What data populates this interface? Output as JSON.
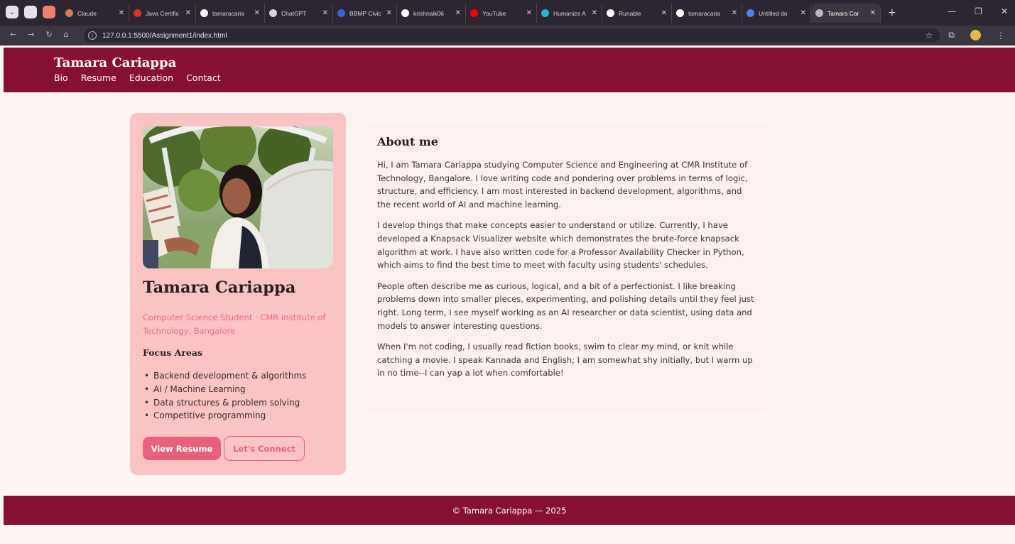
{
  "browser": {
    "tabs": [
      {
        "label": "Claude",
        "icon": "claude-icon",
        "color": "#d97757"
      },
      {
        "label": "Java Certific",
        "icon": "java-icon",
        "color": "#e02e2e"
      },
      {
        "label": "tamaracaria",
        "icon": "github-icon",
        "color": "#ffffff"
      },
      {
        "label": "ChatGPT",
        "icon": "chatgpt-icon",
        "color": "#d9d4dc"
      },
      {
        "label": "BBMP Civic",
        "icon": "bbmp-icon",
        "color": "#3366dd"
      },
      {
        "label": "krishnaik06",
        "icon": "github-icon",
        "color": "#ffffff"
      },
      {
        "label": "YouTube",
        "icon": "youtube-icon",
        "color": "#ff0000"
      },
      {
        "label": "Humanize A",
        "icon": "humanize-icon",
        "color": "#28b4d8"
      },
      {
        "label": "Runable",
        "icon": "runable-icon",
        "color": "#ffffff"
      },
      {
        "label": "tamaracaria",
        "icon": "github-icon",
        "color": "#ffffff"
      },
      {
        "label": "Untitled do",
        "icon": "docs-icon",
        "color": "#4285f4"
      },
      {
        "label": "Tamara Car",
        "icon": "globe-icon",
        "color": "#bdb6c1"
      }
    ],
    "url": "127.0.0.1:5500/Assignment1/index.html"
  },
  "header": {
    "title": "Tamara Cariappa",
    "nav": [
      "Bio",
      "Resume",
      "Education",
      "Contact"
    ]
  },
  "profile": {
    "name": "Tamara Cariappa",
    "subtitle": "Computer Science Student · CMR Institute of Technology, Bangalore",
    "focus_title": "Focus Areas",
    "focus_items": [
      "Backend development & algorithms",
      "AI / Machine Learning",
      "Data structures & problem solving",
      "Competitive programming"
    ],
    "primary_button": "View Resume",
    "secondary_button": "Let's Connect"
  },
  "about": {
    "title": "About me",
    "paragraphs": [
      "Hi, I am Tamara Cariappa studying Computer Science and Engineering at CMR Institute of Technology, Bangalore. I love writing code and pondering over problems in terms of logic, structure, and efficiency. I am most interested in backend development, algorithms, and the recent world of AI and machine learning.",
      "I develop things that make concepts easier to understand or utilize. Currently, I have developed a Knapsack Visualizer website which demonstrates the brute-force knapsack algorithm at work. I have also written code for a Professor Availability Checker in Python, which aims to find the best time to meet with faculty using students' schedules.",
      "People often describe me as curious, logical, and a bit of a perfectionist. I like breaking problems down into smaller pieces, experimenting, and polishing details until they feel just right. Long term, I see myself working as an AI researcher or data scientist, using data and models to answer interesting questions.",
      "When I'm not coding, I usually read fiction books, swim to clear my mind, or knit while catching a movie. I speak Kannada and English; I am somewhat shy initially, but I warm up in no time--I can yap a lot when comfortable!"
    ]
  },
  "footer": {
    "text": "© Tamara Cariappa — 2025"
  },
  "colors": {
    "brand": "#860f33",
    "card": "#fcc3c4",
    "accent": "#e8607e",
    "page_bg": "#fdf5f3"
  }
}
